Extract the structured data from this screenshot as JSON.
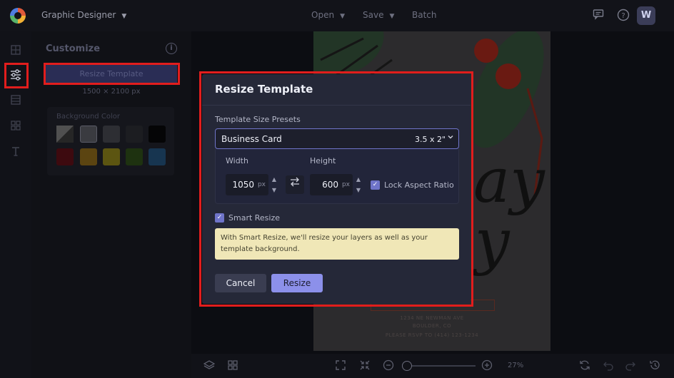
{
  "header": {
    "app_title": "Graphic Designer",
    "menu": {
      "open": "Open",
      "save": "Save",
      "batch": "Batch"
    },
    "avatar_initial": "W"
  },
  "sidebar": {
    "icons": [
      "grid-icon",
      "sliders-icon",
      "layers-list-icon",
      "apps-icon",
      "text-icon"
    ],
    "active": "sliders-icon"
  },
  "customize": {
    "title": "Customize",
    "resize_button": "Resize Template",
    "dimensions": "1500 × 2100 px",
    "background_color_label": "Background Color",
    "swatches": [
      "#d9d9d9",
      "#bfbfbf",
      "#8c8c8c",
      "#4a4a4a",
      "#000000",
      "#7a0e18",
      "#c9961a",
      "#d6c520",
      "#3c6b1c",
      "#2f6fa5"
    ]
  },
  "canvas": {
    "script_text_1": "ay",
    "script_text_2": "y",
    "address_1": "1234 NE NEWMAN AVE",
    "address_2": "BOULDER, CO",
    "rsvp": "PLEASE RSVP TO (414) 123-1234"
  },
  "bottom_toolbar": {
    "zoom": "27%"
  },
  "modal": {
    "title": "Resize Template",
    "presets_label": "Template Size Presets",
    "preset_value": "Business Card",
    "preset_size": "3.5 x 2\"",
    "width_label": "Width",
    "width_value": "1050",
    "width_unit": "px",
    "height_label": "Height",
    "height_value": "600",
    "height_unit": "px",
    "lock_aspect_label": "Lock Aspect Ratio",
    "lock_aspect_checked": true,
    "smart_resize_label": "Smart Resize",
    "smart_resize_checked": true,
    "smart_resize_note": "With Smart Resize, we'll resize your layers as well as your template background.",
    "cancel_label": "Cancel",
    "resize_label": "Resize"
  },
  "colors": {
    "accent": "#8c90ea",
    "highlight_outline": "#e11d1d",
    "note_background": "#f0e7b7"
  }
}
